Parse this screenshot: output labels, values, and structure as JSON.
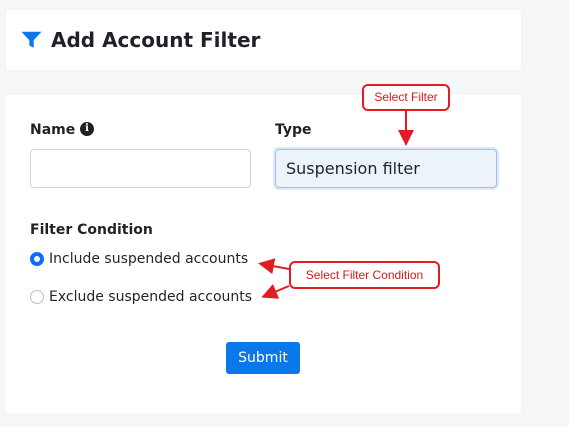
{
  "header": {
    "title": "Add Account Filter",
    "icon": "filter-icon",
    "icon_color": "#0b78ea"
  },
  "form": {
    "name": {
      "label": "Name",
      "info_icon": "info-icon",
      "value": "",
      "placeholder": ""
    },
    "type": {
      "label": "Type",
      "value": "Suspension filter"
    },
    "filter_condition": {
      "label": "Filter Condition",
      "options": [
        {
          "label": "Include suspended accounts",
          "selected": true
        },
        {
          "label": "Exclude suspended accounts",
          "selected": false
        }
      ]
    },
    "submit_label": "Submit"
  },
  "annotations": {
    "select_filter": "Select Filter",
    "select_filter_condition": "Select Filter Condition",
    "color": "#e11d23"
  }
}
